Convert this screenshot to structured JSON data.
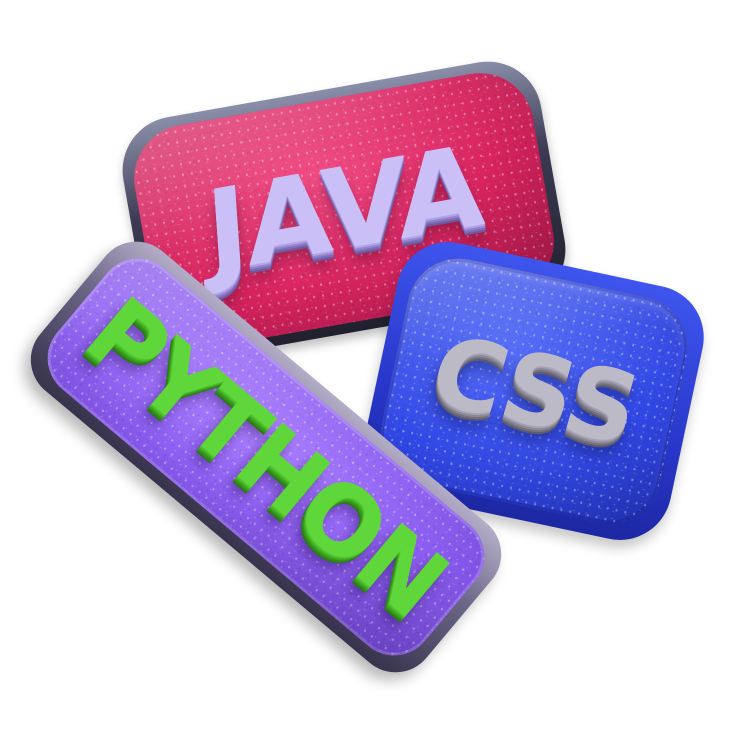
{
  "badges": [
    {
      "id": "java",
      "label": "JAVA",
      "plate_color": "#d8235f",
      "text_color": "#cbbff7"
    },
    {
      "id": "css",
      "label": "CSS",
      "plate_color": "#3148e6",
      "text_color": "#bdbac8"
    },
    {
      "id": "python",
      "label": "PYTHON",
      "plate_color": "#8d5ef2",
      "text_color": "#5fd63a"
    }
  ]
}
